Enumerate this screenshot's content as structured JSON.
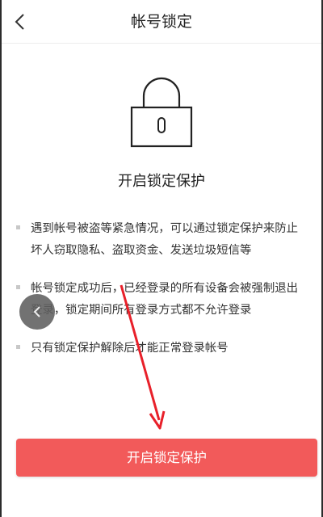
{
  "header": {
    "title": "帐号锁定",
    "back_icon": "chevron-left-icon"
  },
  "hero": {
    "icon": "lock-icon",
    "subtitle": "开启锁定保护"
  },
  "bullets": [
    {
      "line1": "遇到帐号被盗等紧急情况，可以通过锁定保护来防止",
      "line2": "坏人窃取隐私、盗取资金、发送垃圾短信等"
    },
    {
      "line1": "帐号锁定成功后，已经登录的所有设备会被强制退出",
      "line2": "登录，锁定期间所有登录方式都不允许登录"
    },
    {
      "line1": "只有锁定保护解除后才能正常登录帐号"
    }
  ],
  "floating_back": {
    "icon": "chevron-left-icon"
  },
  "action": {
    "label": "开启锁定保护"
  },
  "colors": {
    "accent": "#f25a5a",
    "annotation_arrow": "#e8202a"
  }
}
